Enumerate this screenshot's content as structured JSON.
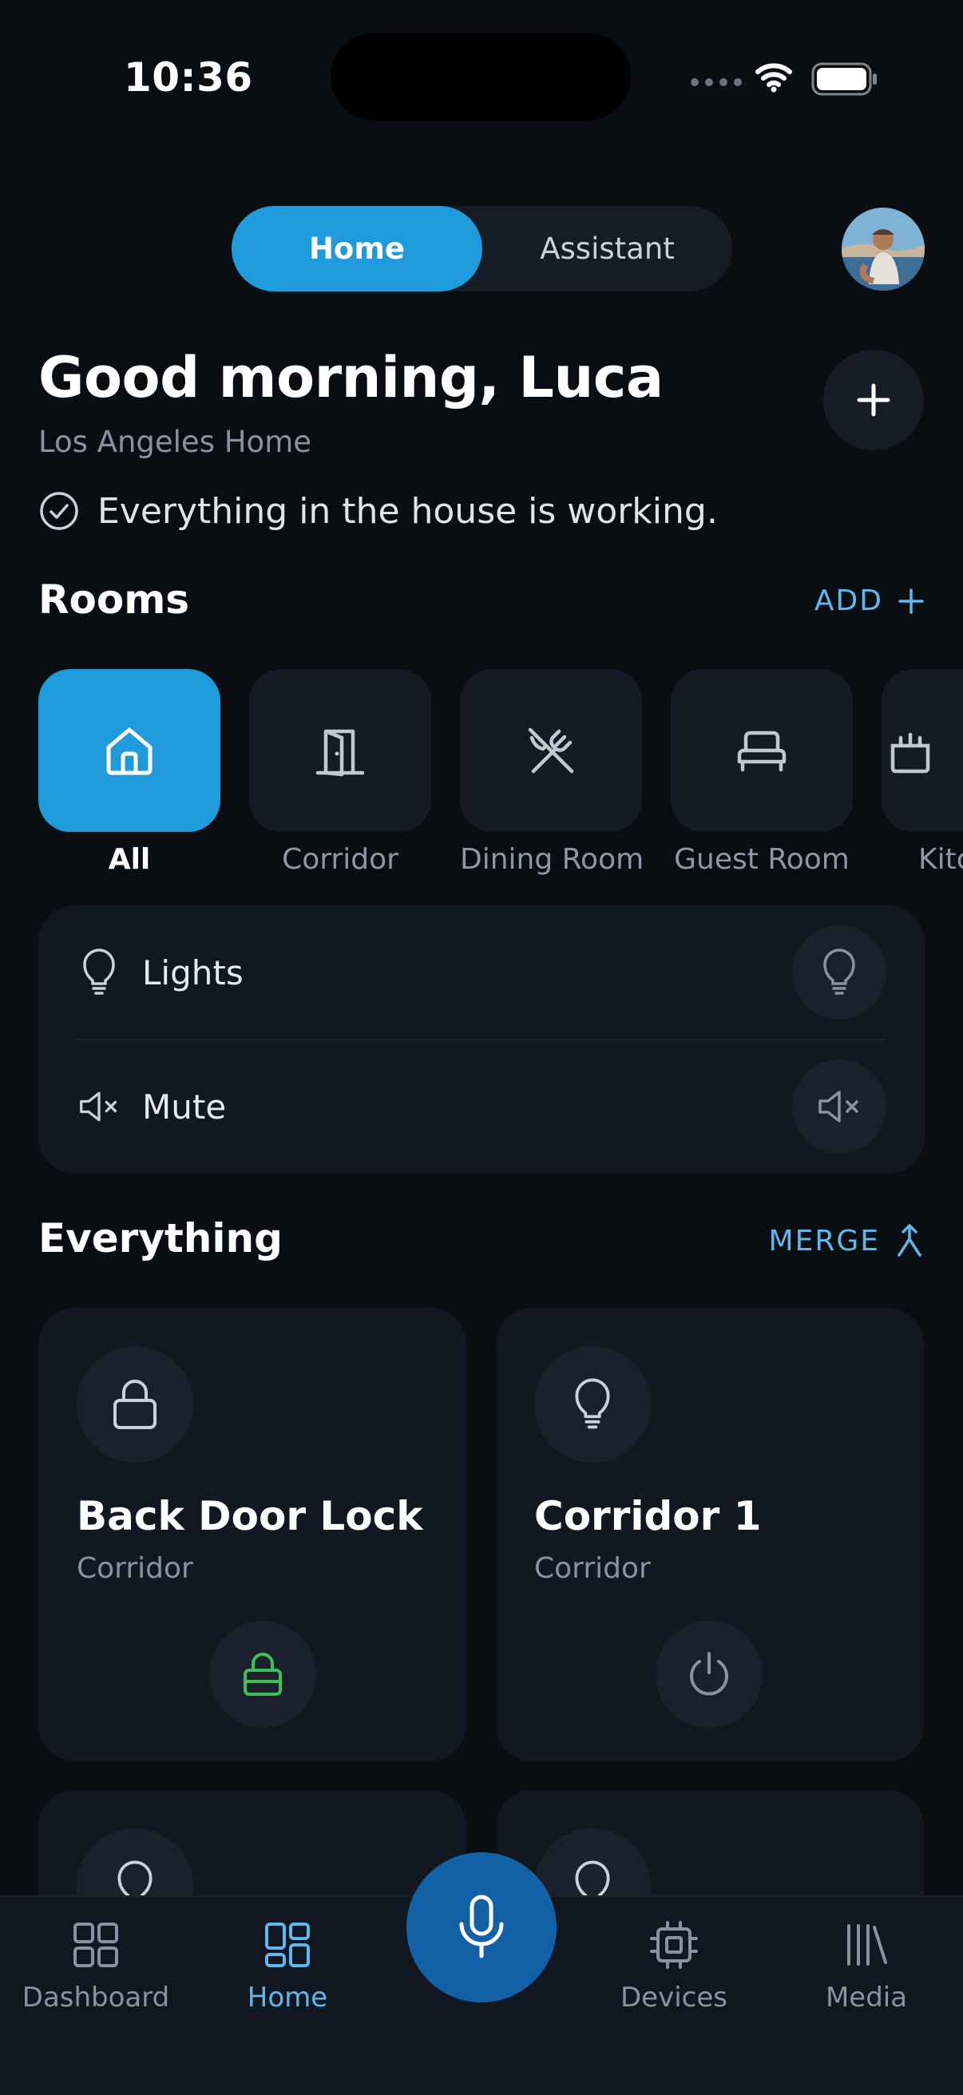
{
  "status_bar": {
    "time": "10:36"
  },
  "segmented": {
    "home": "Home",
    "assistant": "Assistant"
  },
  "greeting": {
    "title": "Good morning, Luca",
    "subtitle": "Los Angeles Home",
    "status": "Everything in the house is working."
  },
  "rooms": {
    "title": "Rooms",
    "action": "ADD",
    "items": [
      {
        "label": "All",
        "icon": "home-icon",
        "active": true
      },
      {
        "label": "Corridor",
        "icon": "door-icon"
      },
      {
        "label": "Dining Room",
        "icon": "utensils-icon"
      },
      {
        "label": "Guest Room",
        "icon": "bed-icon"
      },
      {
        "label": "Kitchen",
        "icon": "kitchen-icon"
      }
    ]
  },
  "quick_actions": {
    "lights": "Lights",
    "mute": "Mute"
  },
  "everything": {
    "title": "Everything",
    "action": "MERGE",
    "cards": [
      {
        "name": "Back Door Lock",
        "room": "Corridor",
        "icon": "lock-icon",
        "action_icon": "lock-icon",
        "action_color": "#3fbf5a"
      },
      {
        "name": "Corridor 1",
        "room": "Corridor",
        "icon": "bulb-icon",
        "action_icon": "power-icon"
      }
    ]
  },
  "nav": {
    "dashboard": "Dashboard",
    "home": "Home",
    "devices": "Devices",
    "media": "Media"
  }
}
